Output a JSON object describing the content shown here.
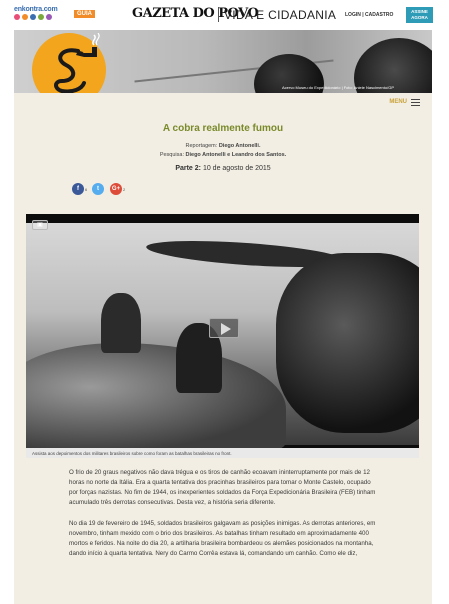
{
  "topbar": {
    "enkontra": "enkontra.com",
    "guia": "GUIA",
    "brand": "GAZETA DO POVO",
    "section": "VIDA E CIDADANIA",
    "login": "LOGIN | CADASTRO",
    "assine": "ASSINE AGORA"
  },
  "hero": {
    "credit": "Acervo Museu do Expedicionário | Foto: Aniele Nascimento/GP"
  },
  "menu": {
    "label": "MENU"
  },
  "article": {
    "title": "A cobra realmente fumou",
    "reporting_label": "Reportagem:",
    "reporting_name": "Diego Antonelli.",
    "research_label": "Pesquisa:",
    "research_names": "Diego Antonelli e Leandro dos Santos.",
    "part_label": "Parte 2:",
    "part_date": "10 de agosto de 2015"
  },
  "share": [
    {
      "icon": "facebook-icon",
      "glyph": "f",
      "count": "6",
      "color": "#3b5998"
    },
    {
      "icon": "twitter-icon",
      "glyph": "t",
      "count": "",
      "color": "#55acee"
    },
    {
      "icon": "google-plus-icon",
      "glyph": "G+",
      "count": "2",
      "color": "#dd4b39"
    }
  ],
  "video": {
    "cc_label": "▣",
    "caption": "Assista aos depoimentos dos militares brasileiros sobre como foram as batalhas brasileiras no front."
  },
  "body": [
    "O frio de 20 graus negativos não dava trégua e os tiros de canhão ecoavam ininterruptamente por mais de 12 horas no norte da Itália. Era a quarta tentativa dos pracinhas brasileiros para tomar o Monte Castelo, ocupado por forças nazistas. No fim de 1944, os inexperientes soldados da Força Expedicionária Brasileira (FEB) tinham acumulado três derrotas consecutivas. Desta vez, a história seria diferente.",
    "No dia 19 de fevereiro de 1945, soldados brasileiros galgavam as posições inimigas. As derrotas anteriores, em novembro, tinham mexido com o brio dos brasileiros. As batalhas tinham resultado em aproximadamente 400 mortos e feridos. Na noite do dia 20, a artilharia brasileira bombardeou os alemães posicionados na montanha, dando início à quarta tentativa. Nery do Carmo Corrêa estava lá, comandando um canhão. Como ele diz,"
  ],
  "colors": {
    "accent_title": "#7a8a2a",
    "menu": "#c9a23a",
    "panel_bg": "#f2eee3",
    "logo": "#f2a51d",
    "assine_bg": "#2e9bb7"
  }
}
